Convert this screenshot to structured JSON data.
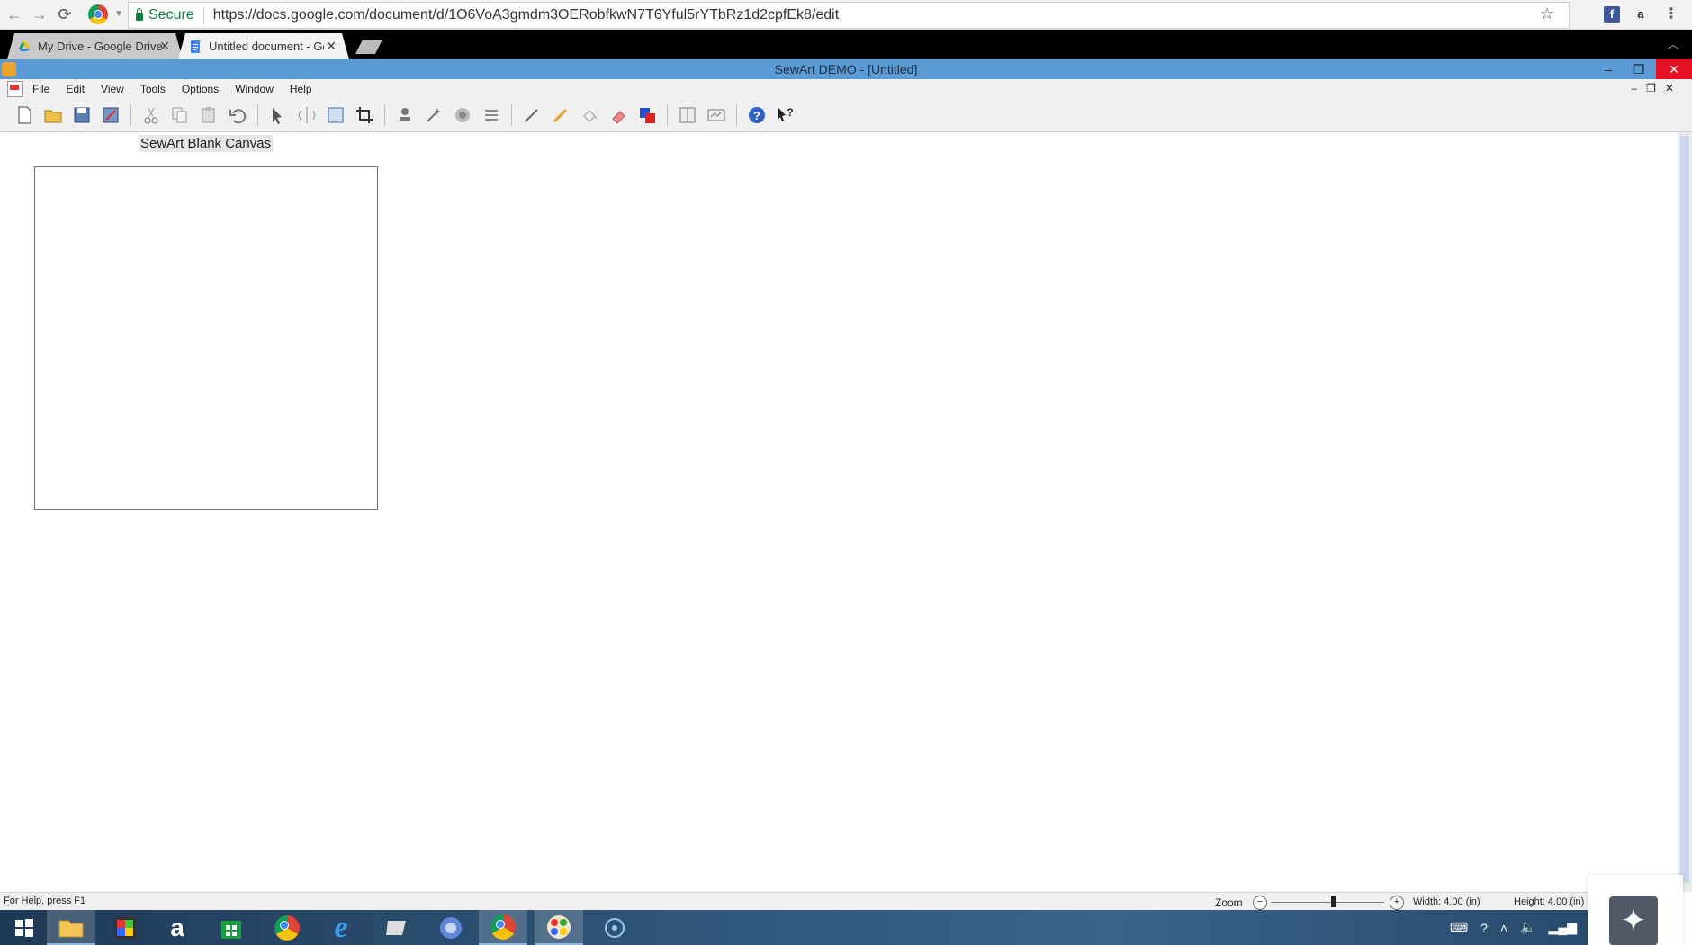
{
  "browser": {
    "secure_label": "Secure",
    "url": "https://docs.google.com/document/d/1O6VoA3gmdm3OERobfkwN7T6Yful5rYTbRz1d2cpfEk8/edit",
    "tabs": [
      {
        "label": "My Drive - Google Drive",
        "active": false
      },
      {
        "label": "Untitled document - Goo",
        "active": true
      }
    ]
  },
  "app": {
    "title": "SewArt DEMO - [Untitled]",
    "menu": [
      "File",
      "Edit",
      "View",
      "Tools",
      "Options",
      "Window",
      "Help"
    ],
    "canvas_label": "SewArt Blank Canvas"
  },
  "status": {
    "help": "For Help, press F1",
    "zoom_label": "Zoom",
    "zoom_level": 0.55,
    "width": "Width: 4.00 (in)",
    "height": "Height: 4.00 (in)"
  },
  "colors": {
    "titlebar": "#5b9bd5",
    "close": "#e81123"
  }
}
